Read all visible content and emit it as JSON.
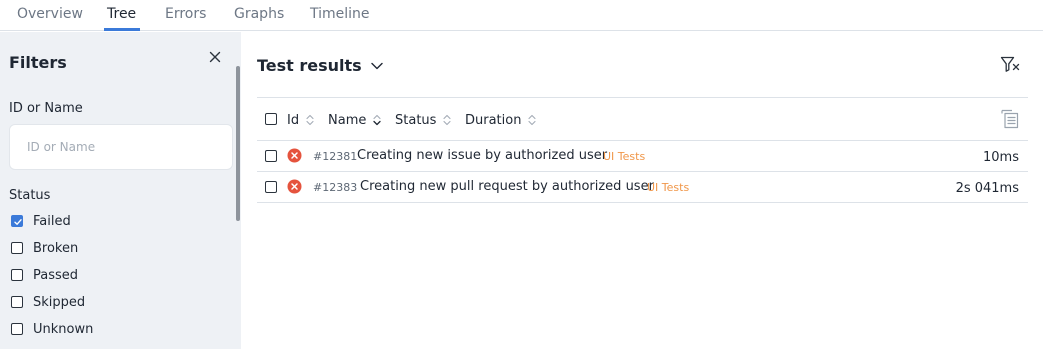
{
  "tabs": [
    {
      "label": "Overview",
      "active": false
    },
    {
      "label": "Tree",
      "active": true
    },
    {
      "label": "Errors",
      "active": false
    },
    {
      "label": "Graphs",
      "active": false
    },
    {
      "label": "Timeline",
      "active": false
    }
  ],
  "filters": {
    "title": "Filters",
    "id_label": "ID or Name",
    "id_placeholder": "ID or Name",
    "id_value": "",
    "status_label": "Status",
    "statuses": [
      {
        "label": "Failed",
        "checked": true
      },
      {
        "label": "Broken",
        "checked": false
      },
      {
        "label": "Passed",
        "checked": false
      },
      {
        "label": "Skipped",
        "checked": false
      },
      {
        "label": "Unknown",
        "checked": false
      }
    ]
  },
  "results": {
    "title": "Test results",
    "columns": {
      "id": "Id",
      "name": "Name",
      "status": "Status",
      "duration": "Duration"
    },
    "rows": [
      {
        "id": "#12381",
        "name": "Creating new issue by authorized user",
        "tag": "UI Tests",
        "duration": "10ms",
        "status": "failed"
      },
      {
        "id": "#12383",
        "name": "Creating new pull request by authorized user",
        "tag": "UI Tests",
        "duration": "2s 041ms",
        "status": "failed"
      }
    ]
  },
  "colors": {
    "accent": "#3b7ad9",
    "failed": "#e5533d",
    "tag": "#f0974a",
    "sidebar_bg": "#eef1f5"
  },
  "icons": {
    "close": "close-icon",
    "dropdown": "chevron-down-icon",
    "clear_filters": "filter-clear-icon",
    "expand_all": "expand-all-icon",
    "failed": "failed-status-icon",
    "sort": "sort-icon"
  }
}
